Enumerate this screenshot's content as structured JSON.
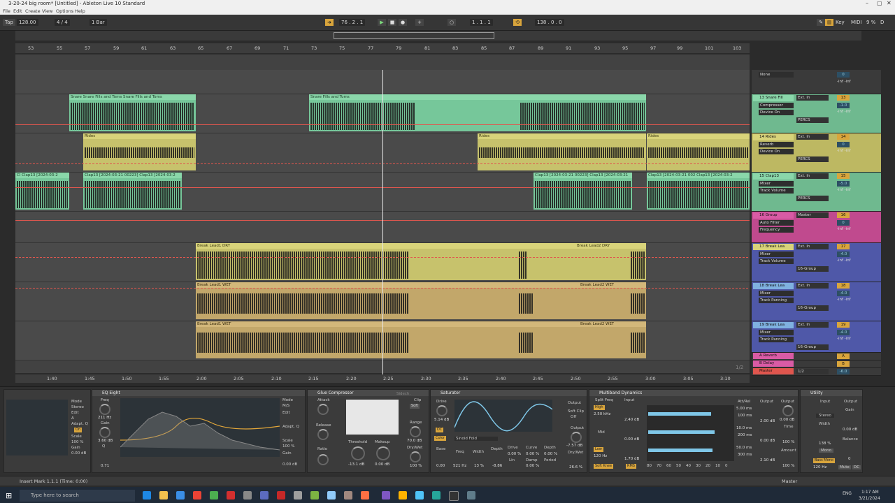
{
  "window": {
    "title": "3-20-24 big room* [Untitled] - Ableton Live 10 Standard"
  },
  "menu": [
    "File",
    "Edit",
    "Create",
    "View",
    "Options",
    "Help"
  ],
  "transport": {
    "tap": "Tap",
    "tempo": "128.00",
    "sig": "4 / 4",
    "quant": "1 Bar",
    "position": "76 .  2 .  1",
    "loop_start": "1 .  1 .  1",
    "loop_len": "138 .  0 .  0",
    "key": "Key",
    "midi": "MIDI",
    "cpu": "9 %",
    "disk": "D"
  },
  "ruler": [
    "53",
    "55",
    "57",
    "59",
    "61",
    "63",
    "65",
    "67",
    "69",
    "71",
    "73",
    "75",
    "77",
    "79",
    "81",
    "83",
    "85",
    "87",
    "89",
    "91",
    "93",
    "95",
    "97",
    "99",
    "101",
    "103"
  ],
  "time_ruler": [
    "1:40",
    "1:45",
    "1:50",
    "1:55",
    "2:00",
    "2:05",
    "2:10",
    "2:15",
    "2:20",
    "2:25",
    "2:30",
    "2:35",
    "2:40",
    "2:45",
    "2:50",
    "2:55",
    "3:00",
    "3:05",
    "3:10"
  ],
  "clips": {
    "snare1": "Snare Snare Fills and Toms   Snare Fills and Toms",
    "snare2": "Snare Fills and Toms",
    "rides": "Rides",
    "clap_a": "Cl  Clap13 [2024-03-2",
    "clap_b": "Clap13 [2024-03-21 00223] Clap13 [2024-03-2",
    "clap_c": "Clap13 [2024-03-21 00223] Clap13 [2024-03-21",
    "clap_d": "Clap13 [2024-03-21 002  Clap13 [2024-03-2",
    "dry1": "Break Lead1 DRY",
    "dry2": "Break Lead2 DRY",
    "wet1": "Break Lead1 WET",
    "wet2": "Break Lead2 WET"
  },
  "tracks": [
    {
      "name": "None",
      "dev1": "",
      "dev2": "",
      "io": "",
      "num": "",
      "vol": "0",
      "extra": "-inf  -inf"
    },
    {
      "name": "13 Snare Fill",
      "dev1": "Compressor",
      "dev2": "Device On",
      "io": "Ext. In",
      "group": "PERCS",
      "num": "13",
      "vol": "-1.0",
      "extra": "-inf  -inf"
    },
    {
      "name": "14 Rides",
      "dev1": "Reverb",
      "dev2": "Device On",
      "io": "Ext. In",
      "group": "PERCS",
      "num": "14",
      "vol": "0",
      "extra": "-inf  -inf"
    },
    {
      "name": "15 Clap13",
      "dev1": "Mixer",
      "dev2": "Track Volume",
      "io": "Ext. In",
      "group": "PERCS",
      "num": "15",
      "vol": "-5.0",
      "extra": "-inf  -inf"
    },
    {
      "name": "16 Group",
      "dev1": "Auto Filter",
      "dev2": "Frequency",
      "io": "Master",
      "group": "",
      "num": "16",
      "vol": "0",
      "extra": "-inf  -inf"
    },
    {
      "name": "17 Break Lea",
      "dev1": "Mixer",
      "dev2": "Track Volume",
      "io": "Ext. In",
      "group": "16-Group",
      "num": "17",
      "vol": "-4.0",
      "extra": "-inf  -inf"
    },
    {
      "name": "18 Break Lea",
      "dev1": "Mixer",
      "dev2": "Track Panning",
      "io": "Ext. In",
      "group": "16-Group",
      "num": "18",
      "vol": "-4.0",
      "extra": "-inf  -inf"
    },
    {
      "name": "19 Break Lea",
      "dev1": "Mixer",
      "dev2": "Track Panning",
      "io": "Ext. In",
      "group": "16-Group",
      "num": "19",
      "vol": "-4.0",
      "extra": "-inf  -inf"
    }
  ],
  "returns": [
    {
      "name": "A Reverb",
      "num": "A"
    },
    {
      "name": "B Delay",
      "num": "B"
    },
    {
      "name": "Master",
      "num": "1/2"
    }
  ],
  "master_vol": "-6.0",
  "page_indicator": "1/2",
  "devices": {
    "eq_left": {
      "mode": "Mode",
      "stereo": "Stereo",
      "edit": "Edit",
      "a": "A",
      "adapt": "Adapt. Q",
      "on": "On",
      "scale": "Scale",
      "scale_val": "100 %",
      "gain": "Gain",
      "gain_val": "0.00 dB"
    },
    "eq": {
      "title": "EQ Eight",
      "freq": "Freq",
      "freq_val": "211 Hz",
      "gain": "Gain",
      "gain_val": "3.60 dB",
      "q": "Q",
      "q_val": "0.71",
      "mode": "Mode",
      "ms": "M/S",
      "edit": "Edit",
      "adapt": "Adapt. Q",
      "scale": "Scale",
      "scale_val": "100 %",
      "gain2": "Gain",
      "gain2_val": "0.00 dB"
    },
    "glue": {
      "title": "Glue Compressor",
      "attack": "Attack",
      "release": "Release",
      "ratio": "Ratio",
      "threshold": "Threshold",
      "thr_val": "-13.1 dB",
      "makeup": "Makeup",
      "mk_val": "0.00 dB",
      "clip": "Clip",
      "soft": "Soft",
      "range": "Range",
      "range_val": "70.0 dB",
      "drywet": "Dry/Wet",
      "dw_val": "100 %",
      "sidechain": "Sidech."
    },
    "saturator": {
      "title": "Saturator",
      "drive": "Drive",
      "drive_val": "5.14 dB",
      "dc": "DC",
      "color": "Color",
      "mode": "Sinoid Fold",
      "base": "Base",
      "base_val": "0.00",
      "freq": "Freq",
      "freq_val": "521 Hz",
      "width": "Width",
      "width_val": "13 %",
      "depth": "Depth",
      "depth_val": "-8.86",
      "drive2": "Drive",
      "curve": "Curve",
      "depth2": "Depth",
      "lin": "Lin",
      "damp": "Damp",
      "period": "Period",
      "v1": "0.00 %",
      "v2": "0.00 %",
      "v3": "0.00 %",
      "v4": "0.00 %",
      "output": "Output",
      "out_val": "-7.57 dB",
      "softclip": "Soft Clip",
      "off": "Off",
      "drywet": "Dry/Wet",
      "dw_val": "26.6 %"
    },
    "multiband": {
      "title": "Multiband Dynamics",
      "split": "Split Freq",
      "input": "Input",
      "high": "High",
      "high_val": "2.50 kHz",
      "mid": "Mid",
      "low": "Low",
      "low_val": "120 Hz",
      "in1": "2.40 dB",
      "in2": "0.00 dB",
      "in3": "1.70 dB",
      "softknee": "Soft Knee",
      "rms": "RMS",
      "attrel": "Att/Rel",
      "a1": "5.00 ms",
      "r1": "100 ms",
      "a2": "10.0 ms",
      "r2": "200 ms",
      "a3": "50.0 ms",
      "r3": "300 ms",
      "output": "Output",
      "o1": "2.00 dB",
      "o2": "0.00 dB",
      "o3": "2.10 dB",
      "out": "Output",
      "out_val": "0.00 dB",
      "time": "Time",
      "time_val": "100 %",
      "amount": "Amount",
      "amount_val": "100 %",
      "scale": [
        "80",
        "70",
        "60",
        "50",
        "40",
        "30",
        "20",
        "10",
        "0"
      ]
    },
    "utility": {
      "title": "Utility",
      "input": "Input",
      "stereo": "Stereo",
      "width": "Width",
      "width_val": "138 %",
      "mono": "Mono",
      "bass_mono": "Bass Mono",
      "bm_val": "120 Hz",
      "output": "Output",
      "gain": "Gain",
      "gain_val": "0.00 dB",
      "balance": "Balance",
      "bal_val": "0",
      "mute": "Mute",
      "dc": "DC"
    }
  },
  "status": {
    "text": "Insert Mark 1.1.1 (Time: 0:00)",
    "master": "Master"
  },
  "taskbar": {
    "search": "Type here to search",
    "time": "1:17 AM",
    "date": "3/21/2024",
    "lang": "ENG"
  },
  "colors": {
    "accent": "#d9a53c",
    "green_clip": "#76c79a",
    "yellow_clip": "#c7c26c",
    "khaki_clip": "#c2a76a",
    "automation": "#e0564e"
  }
}
